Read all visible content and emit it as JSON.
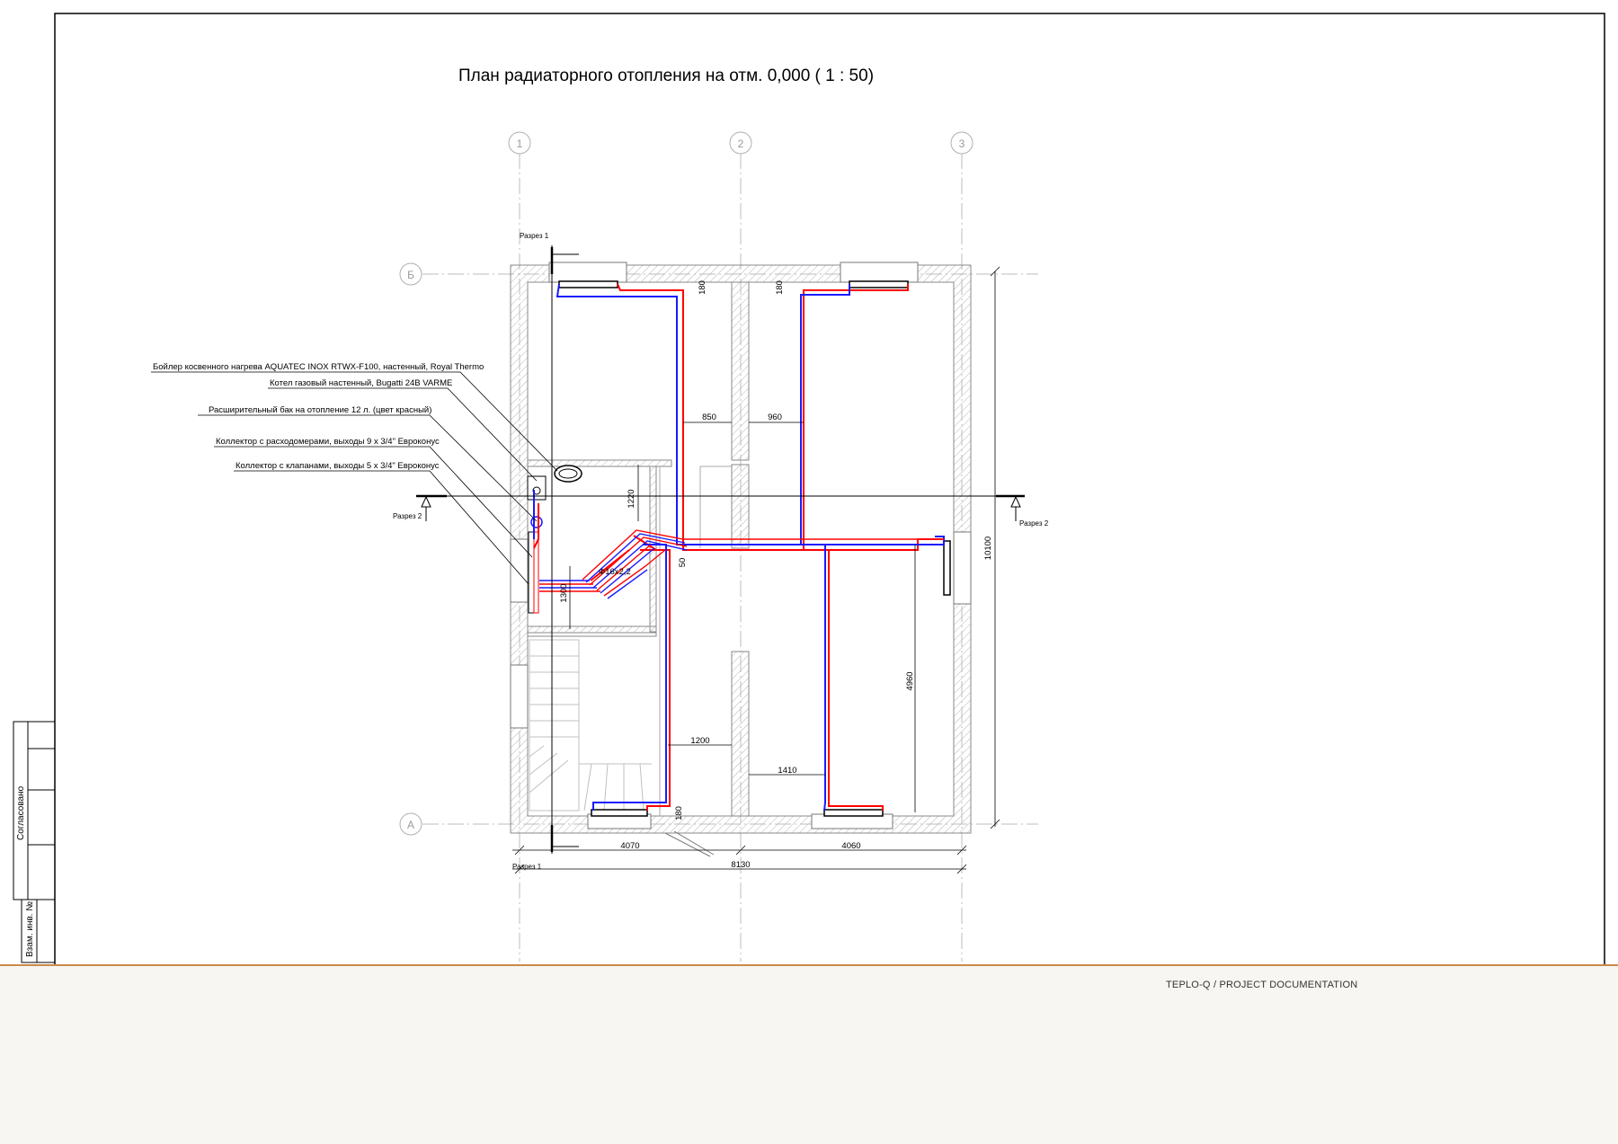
{
  "drawing": {
    "title": "План радиаторного отопления на отм. 0,000 ( 1 : 50)",
    "axes": {
      "col1": "1",
      "col2": "2",
      "col3": "3",
      "rowB": "Б",
      "rowA": "А"
    },
    "sections": {
      "s1_top": "Разрез 1",
      "s1_bottom": "Разрез 1",
      "s2_left": "Разрез 2",
      "s2_right": "Разрез 2"
    },
    "callouts": [
      "Бойлер косвенного нагрева AQUATEC INOX RTWX-F100, настенный, Royal Thermo",
      "Котел газовый настенный, Bugatti 24B VARME",
      "Расширительный бак на отопление 12 л. (цвет красный)",
      "Коллектор с расходомерами, выходы 9 х 3/4\" Евроконус",
      "Коллектор с клапанами, выходы 5 х 3/4\" Евроконус"
    ],
    "dims": {
      "d180a": "180",
      "d180b": "180",
      "d180c": "180",
      "d850": "850",
      "d960": "960",
      "d1220": "1220",
      "d50": "50",
      "d1300": "1300",
      "d1200": "1200",
      "d1410": "1410",
      "d4960": "4960",
      "d10100": "10100",
      "d4070": "4070",
      "d4060": "4060",
      "d8130": "8130",
      "pipe": "Ф16х2,2"
    }
  },
  "stamp": {
    "agreed": "Согласовано",
    "inv": "Взам. инв. №"
  },
  "footer": {
    "text": "TEPLO-Q / PROJECT DOCUMENTATION"
  },
  "colors": {
    "supply": "#ff0000",
    "return": "#1a1aff",
    "wall": "#8a8a8a",
    "line": "#000000"
  }
}
